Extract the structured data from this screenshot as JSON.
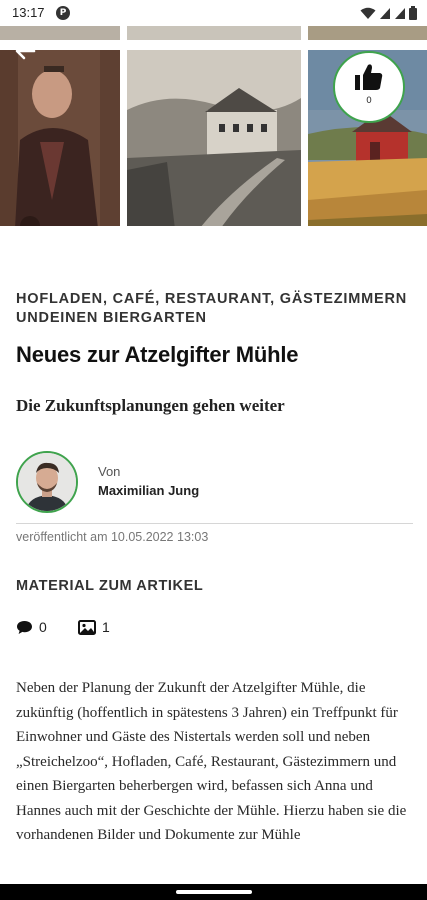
{
  "status_bar": {
    "time": "13:17",
    "app_badge": "P",
    "icons": [
      "wifi-icon",
      "signal-icon",
      "signal-icon",
      "battery-icon"
    ]
  },
  "gallery": {
    "photos": [
      "portrait-photo",
      "landscape-photo",
      "farm-painting-photo"
    ],
    "like_count": "0"
  },
  "article": {
    "category": "HOFLADEN, CAFÉ, RESTAURANT, GÄSTEZIMMERN UNDEINEN BIERGARTEN",
    "title": "Neues zur Atzelgifter Mühle",
    "subtitle": "Die Zukunftsplanungen gehen weiter",
    "author_prefix": "Von",
    "author_name": "Maximilian Jung",
    "published": "veröffentlicht am 10.05.2022 13:03",
    "material_heading": "MATERIAL ZUM ARTIKEL",
    "comment_count": "0",
    "image_count": "1",
    "body": "Neben der Planung der Zukunft der Atzelgifter Mühle, die zukünftig (hoffentlich in spätestens 3 Jahren) ein Treffpunkt für Einwohner und Gäste des Nistertals werden soll und neben „Streichelzoo“, Hofladen, Café, Restaurant, Gästezimmern und einen Biergarten beherbergen wird, befassen sich Anna und Hannes auch mit der Geschichte der Mühle. Hierzu haben sie die vorhandenen Bilder und Dokumente zur Mühle"
  },
  "colors": {
    "accent_green": "#3fa34d",
    "text_dark": "#111111",
    "text_muted": "#777777"
  }
}
